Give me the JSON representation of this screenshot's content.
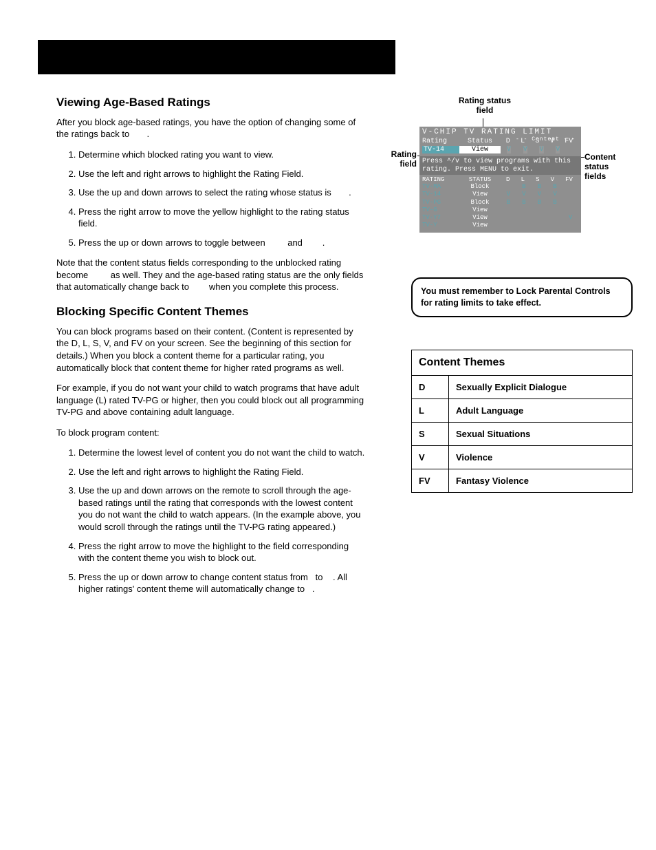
{
  "section1": {
    "heading": "Viewing Age-Based Ratings",
    "intro": "After you block age-based ratings, you have the option of changing some of the ratings back to       .",
    "steps": [
      "Determine which blocked rating you want to view.",
      "Use the left and right arrows to highlight the Rating Field.",
      "Use the up and down arrows to select the rating whose status is       .",
      "Press the right arrow to move the yellow highlight to the rating status field.",
      "Press the up or down arrows to toggle between         and        ."
    ],
    "note": "Note that the content status fields corresponding to the unblocked rating become         as well. They and the age-based rating status are the only fields that automatically change back to        when you complete this process."
  },
  "section2": {
    "heading": "Blocking Specific Content Themes",
    "p1": "You can block programs based on their content. (Content is represented by the D, L, S, V, and FV on your screen. See the beginning of this section for details.) When you block a content theme for a particular rating, you automatically block that content theme for higher rated programs as well.",
    "p2": "For example, if you do not want your child to watch programs that have adult language (L) rated TV-PG or higher, then you could block out all programming TV-PG and above containing adult language.",
    "p3": "To block program content:",
    "steps": [
      "Determine the lowest level of content you do not want the child to watch.",
      "Use the left and right arrows to highlight the Rating Field.",
      "Use the up and down arrows on the remote to scroll through the age-based ratings until the rating that corresponds with the lowest content you do not want the child to watch appears.  (In the example above, you would scroll through the ratings until the TV-PG rating appeared.)",
      "Press the right arrow to move the highlight to the field corresponding with the content theme you wish to block out.",
      "Press the up or down arrow to change content status from   to    . All higher ratings' content theme will automatically change to   ."
    ]
  },
  "labels": {
    "rating_status_field": "Rating status field",
    "rating_field": "Rating field",
    "content_status_fields": "Content status fields"
  },
  "diagram": {
    "title": "V-CHIP TV RATING LIMIT",
    "content_label": "- - Content - -",
    "cols_hdr_rating": "Rating",
    "cols_hdr_status": "Status",
    "content_cols": [
      "D",
      "L",
      "S",
      "V",
      "FV"
    ],
    "sel_rating": "TV-14",
    "sel_status": "View",
    "sel_cells": [
      "V",
      "V",
      "V",
      "V",
      ""
    ],
    "msg": "Press ^/v to view programs with this rating. Press MENU to exit.",
    "table_header_rating": "RATING",
    "table_header_status": "STATUS",
    "rows": [
      {
        "r": "TV-MA",
        "s": "Block",
        "c": [
          "",
          "B",
          "B",
          "B",
          ""
        ]
      },
      {
        "r": "TV-14",
        "s": "View",
        "c": [
          "V",
          "V",
          "V",
          "V",
          ""
        ]
      },
      {
        "r": "TV-PG",
        "s": "Block",
        "c": [
          "B",
          "B",
          "B",
          "B",
          ""
        ]
      },
      {
        "r": "TV-G",
        "s": "View",
        "c": [
          "",
          "",
          "",
          "",
          ""
        ]
      },
      {
        "r": "TV-Y7",
        "s": "View",
        "c": [
          "",
          "",
          "",
          "",
          "V"
        ]
      },
      {
        "r": "TV-Y",
        "s": "View",
        "c": [
          "",
          "",
          "",
          "",
          ""
        ]
      }
    ]
  },
  "warning": "You must remember to Lock Parental Controls for rating limits to take effect.",
  "themes": {
    "heading": "Content Themes",
    "rows": [
      {
        "code": "D",
        "desc": "Sexually Explicit Dialogue"
      },
      {
        "code": "L",
        "desc": "Adult Language"
      },
      {
        "code": "S",
        "desc": "Sexual Situations"
      },
      {
        "code": "V",
        "desc": "Violence"
      },
      {
        "code": "FV",
        "desc": "Fantasy Violence"
      }
    ]
  }
}
